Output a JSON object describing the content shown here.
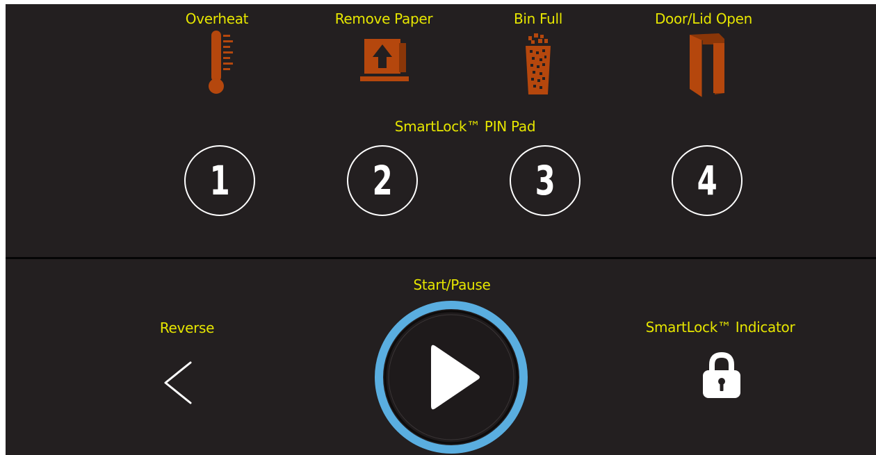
{
  "colors": {
    "panel_bg": "#231f20",
    "label": "#e6e600",
    "icon_orange": "#b5470d",
    "start_ring": "#5aaee0",
    "white": "#ffffff"
  },
  "status_indicators": {
    "overheat": {
      "label": "Overheat",
      "icon": "thermometer-icon"
    },
    "remove_paper": {
      "label": "Remove Paper",
      "icon": "remove-paper-icon"
    },
    "bin_full": {
      "label": "Bin Full",
      "icon": "bin-full-icon"
    },
    "door_open": {
      "label": "Door/Lid Open",
      "icon": "door-open-icon"
    }
  },
  "pin_pad": {
    "title": "SmartLock™ PIN Pad",
    "keys": [
      "1",
      "2",
      "3",
      "4"
    ]
  },
  "controls": {
    "reverse": {
      "label": "Reverse",
      "icon": "chevron-left-icon"
    },
    "start_pause": {
      "label": "Start/Pause",
      "icon": "play-icon"
    },
    "smartlock_indicator": {
      "label": "SmartLock™ Indicator",
      "icon": "lock-icon"
    }
  }
}
